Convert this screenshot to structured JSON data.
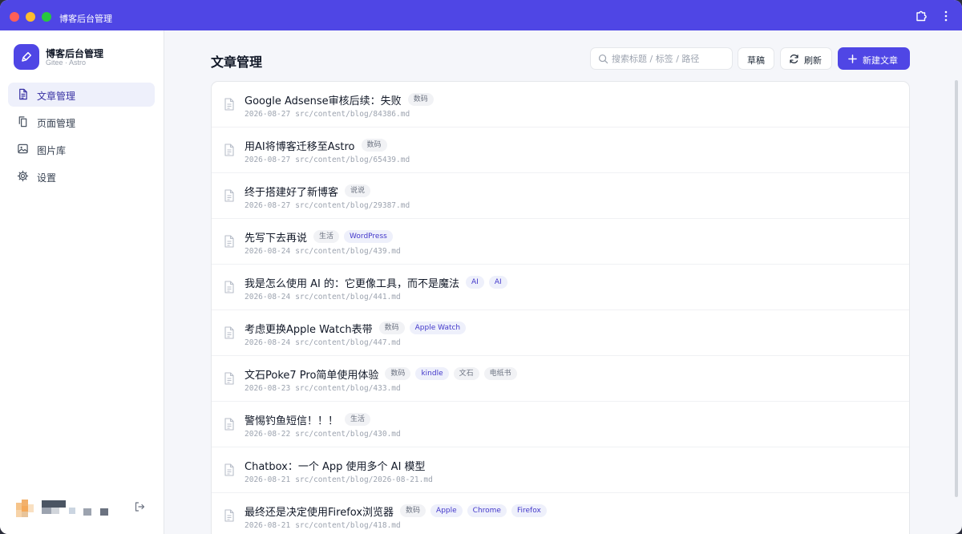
{
  "window": {
    "title": "博客后台管理"
  },
  "brand": {
    "name": "博客后台管理",
    "subtitle": "Gitee · Astro"
  },
  "nav": [
    {
      "label": "文章管理",
      "icon": "file-text-icon",
      "active": true
    },
    {
      "label": "页面管理",
      "icon": "pages-icon",
      "active": false
    },
    {
      "label": "图片库",
      "icon": "image-icon",
      "active": false
    },
    {
      "label": "设置",
      "icon": "gear-icon",
      "active": false
    }
  ],
  "header": {
    "title": "文章管理",
    "search_placeholder": "搜索标题 / 标签 / 路径",
    "draft_label": "草稿",
    "refresh_label": "刷新",
    "new_label": "新建文章"
  },
  "colors": {
    "accent": "#4f46e5",
    "tag_bg": "#eef0fb",
    "tag_text": "#4338ca"
  },
  "posts": [
    {
      "title": "Google Adsense审核后续：失败",
      "tags": [
        "数码"
      ],
      "date": "2026-08-27",
      "path": "src/content/blog/84386.md"
    },
    {
      "title": "用AI将博客迁移至Astro",
      "tags": [
        "数码"
      ],
      "date": "2026-08-27",
      "path": "src/content/blog/65439.md"
    },
    {
      "title": "终于搭建好了新博客",
      "tags": [
        "说说"
      ],
      "date": "2026-08-27",
      "path": "src/content/blog/29387.md"
    },
    {
      "title": "先写下去再说",
      "tags": [
        "生活",
        "WordPress"
      ],
      "date": "2026-08-24",
      "path": "src/content/blog/439.md"
    },
    {
      "title": "我是怎么使用 AI 的：它更像工具，而不是魔法",
      "tags": [
        "AI",
        "AI"
      ],
      "date": "2026-08-24",
      "path": "src/content/blog/441.md"
    },
    {
      "title": "考虑更换Apple Watch表带",
      "tags": [
        "数码",
        "Apple Watch"
      ],
      "date": "2026-08-24",
      "path": "src/content/blog/447.md"
    },
    {
      "title": "文石Poke7 Pro简单使用体验",
      "tags": [
        "数码",
        "kindle",
        "文石",
        "电纸书"
      ],
      "date": "2026-08-23",
      "path": "src/content/blog/433.md"
    },
    {
      "title": "警惕钓鱼短信！！！",
      "tags": [
        "生活"
      ],
      "date": "2026-08-22",
      "path": "src/content/blog/430.md"
    },
    {
      "title": "Chatbox：一个 App 使用多个 AI 模型",
      "tags": [],
      "date": "2026-08-21",
      "path": "src/content/blog/2026-08-21.md"
    },
    {
      "title": "最终还是决定使用Firefox浏览器",
      "tags": [
        "数码",
        "Apple",
        "Chrome",
        "Firefox"
      ],
      "date": "2026-08-21",
      "path": "src/content/blog/418.md"
    }
  ]
}
